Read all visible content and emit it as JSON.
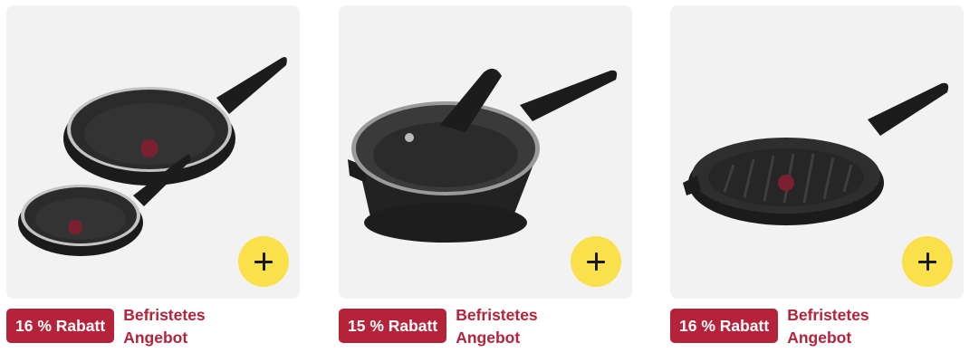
{
  "colors": {
    "card_background": "#f2f2f2",
    "add_button": "#fae04b",
    "discount_badge": "#b5233a",
    "offer_text": "#b5233a"
  },
  "products": [
    {
      "image_icon": "frying-pan-set-icon",
      "add_button_icon": "plus-icon",
      "discount_label": "16 % Rabatt",
      "offer_line1": "Befristetes",
      "offer_line2": "Angebot"
    },
    {
      "image_icon": "saute-pan-with-lid-icon",
      "add_button_icon": "plus-icon",
      "discount_label": "15 % Rabatt",
      "offer_line1": "Befristetes",
      "offer_line2": "Angebot"
    },
    {
      "image_icon": "grill-pan-icon",
      "add_button_icon": "plus-icon",
      "discount_label": "16 % Rabatt",
      "offer_line1": "Befristetes",
      "offer_line2": "Angebot"
    }
  ]
}
